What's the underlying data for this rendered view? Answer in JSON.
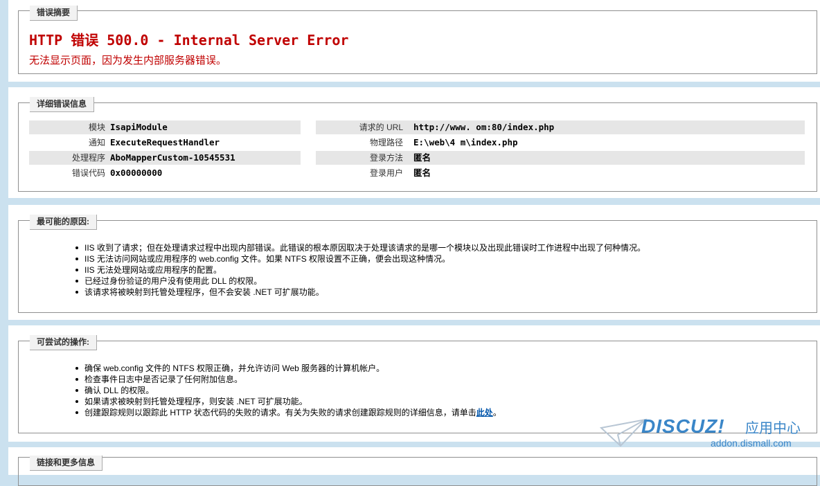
{
  "summary": {
    "legend": "错误摘要",
    "title": "HTTP 错误 500.0 - Internal Server Error",
    "subtitle": "无法显示页面，因为发生内部服务器错误。"
  },
  "details": {
    "legend": "详细错误信息",
    "left": [
      {
        "label": "模块",
        "value": "IsapiModule"
      },
      {
        "label": "通知",
        "value": "ExecuteRequestHandler"
      },
      {
        "label": "处理程序",
        "value": "AboMapperCustom-10545531"
      },
      {
        "label": "错误代码",
        "value": "0x00000000"
      }
    ],
    "right": [
      {
        "label": "请求的 URL",
        "value": "http://www.          om:80/index.php"
      },
      {
        "label": "物理路径",
        "value": "E:\\web\\4          m\\index.php"
      },
      {
        "label": "登录方法",
        "value": "匿名"
      },
      {
        "label": "登录用户",
        "value": "匿名"
      }
    ]
  },
  "causes": {
    "legend": "最可能的原因:",
    "items": [
      "IIS 收到了请求；但在处理请求过程中出现内部错误。此错误的根本原因取决于处理该请求的是哪一个模块以及出现此错误时工作进程中出现了何种情况。",
      "IIS 无法访问网站或应用程序的 web.config 文件。如果 NTFS 权限设置不正确，便会出现这种情况。",
      "IIS 无法处理网站或应用程序的配置。",
      "已经过身份验证的用户没有使用此 DLL 的权限。",
      "该请求将被映射到托管处理程序，但不会安装 .NET 可扩展功能。"
    ]
  },
  "actions": {
    "legend": "可尝试的操作:",
    "items": [
      "确保 web.config 文件的 NTFS 权限正确，并允许访问 Web 服务器的计算机帐户。",
      "检查事件日志中是否记录了任何附加信息。",
      "确认 DLL 的权限。",
      "如果请求被映射到托管处理程序，则安装 .NET 可扩展功能。",
      "创建跟踪规则以跟踪此 HTTP 状态代码的失败的请求。有关为失败的请求创建跟踪规则的详细信息，请单击"
    ],
    "link_text": "此处",
    "link_suffix": "。"
  },
  "more": {
    "legend": "链接和更多信息"
  },
  "watermark": {
    "logo": "DISCUZ!",
    "cn": "应用中心",
    "url": "addon.dismall.com"
  }
}
